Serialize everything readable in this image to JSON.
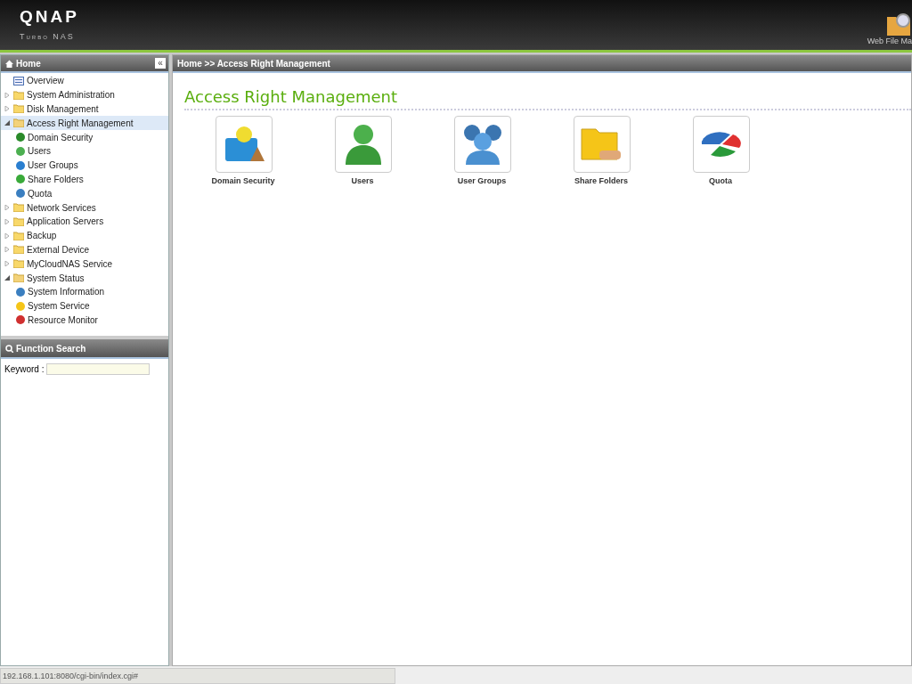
{
  "header": {
    "logo": "QNAP",
    "subtitle": "Turbo NAS",
    "shortcut": "Web File Ma"
  },
  "sidebar": {
    "title": "Home",
    "collapse": "«",
    "items": [
      {
        "kind": "page",
        "label": "Overview",
        "selected": false
      },
      {
        "kind": "folder",
        "label": "System Administration",
        "expanded": false,
        "selected": false
      },
      {
        "kind": "folder",
        "label": "Disk Management",
        "expanded": false,
        "selected": false
      },
      {
        "kind": "folder",
        "label": "Access Right Management",
        "expanded": true,
        "selected": true,
        "children": [
          {
            "label": "Domain Security",
            "selected": false
          },
          {
            "label": "Users",
            "selected": false
          },
          {
            "label": "User Groups",
            "selected": false
          },
          {
            "label": "Share Folders",
            "selected": false
          },
          {
            "label": "Quota",
            "selected": false
          }
        ]
      },
      {
        "kind": "folder",
        "label": "Network Services",
        "expanded": false,
        "selected": false
      },
      {
        "kind": "folder",
        "label": "Application Servers",
        "expanded": false,
        "selected": false
      },
      {
        "kind": "folder",
        "label": "Backup",
        "expanded": false,
        "selected": false
      },
      {
        "kind": "folder",
        "label": "External Device",
        "expanded": false,
        "selected": false
      },
      {
        "kind": "folder",
        "label": "MyCloudNAS Service",
        "expanded": false,
        "selected": false
      },
      {
        "kind": "folder",
        "label": "System Status",
        "expanded": true,
        "selected": false,
        "children": [
          {
            "label": "System Information",
            "selected": false
          },
          {
            "label": "System Service",
            "selected": false
          },
          {
            "label": "Resource Monitor",
            "selected": false
          }
        ]
      }
    ]
  },
  "function_search": {
    "title": "Function Search",
    "keyword_label": "Keyword :"
  },
  "breadcrumb": "Home >> Access Right Management",
  "page_title": "Access Right Management",
  "tiles": [
    {
      "label": "Domain Security"
    },
    {
      "label": "Users"
    },
    {
      "label": "User Groups"
    },
    {
      "label": "Share Folders"
    },
    {
      "label": "Quota"
    }
  ],
  "status_bar": "192.168.1.101:8080/cgi-bin/index.cgi#"
}
